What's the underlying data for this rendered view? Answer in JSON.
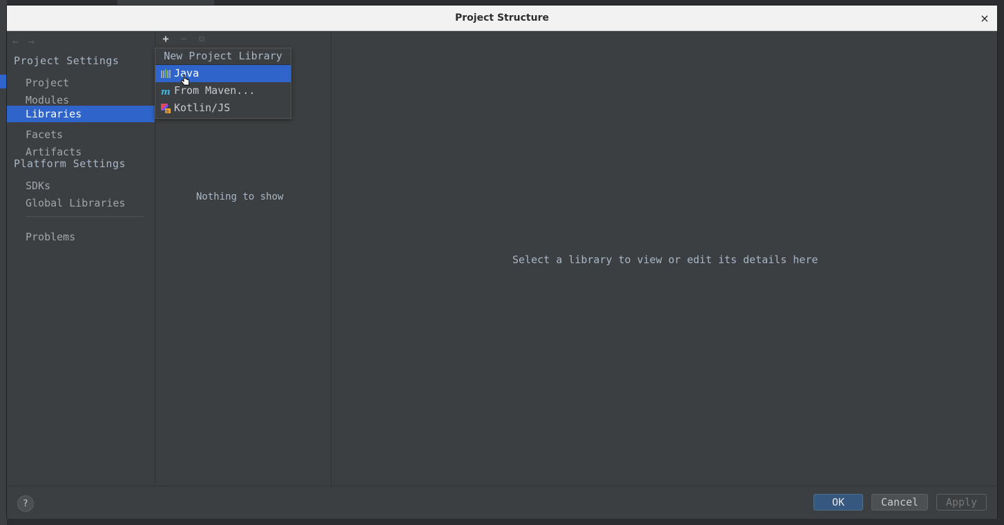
{
  "window": {
    "title": "Project Structure",
    "close_glyph": "×"
  },
  "nav": {
    "back_glyph": "←",
    "forward_glyph": "→",
    "project_settings_header": "Project Settings",
    "project_items": [
      {
        "label": "Project"
      },
      {
        "label": "Modules"
      },
      {
        "label": "Libraries",
        "selected": true
      },
      {
        "label": "Facets"
      },
      {
        "label": "Artifacts"
      }
    ],
    "platform_settings_header": "Platform Settings",
    "platform_items": [
      {
        "label": "SDKs"
      },
      {
        "label": "Global Libraries"
      }
    ],
    "problems_label": "Problems"
  },
  "libraries_panel": {
    "toolbar": {
      "add_glyph": "+",
      "remove_glyph": "−",
      "copy_glyph": "⧉"
    },
    "empty_text": "Nothing to show"
  },
  "popup": {
    "title": "New Project Library",
    "items": [
      {
        "label": "Java",
        "icon": "library-icon",
        "selected": true
      },
      {
        "label": "From Maven...",
        "icon": "maven-icon"
      },
      {
        "label": "Kotlin/JS",
        "icon": "kotlin-js-icon"
      }
    ]
  },
  "details": {
    "hint": "Select a library to view or edit its details here"
  },
  "buttons": {
    "help": "?",
    "ok": "OK",
    "cancel": "Cancel",
    "apply": "Apply"
  },
  "colors": {
    "selection": "#2f65ca",
    "background": "#3c3f41",
    "ok_button": "#365880"
  }
}
